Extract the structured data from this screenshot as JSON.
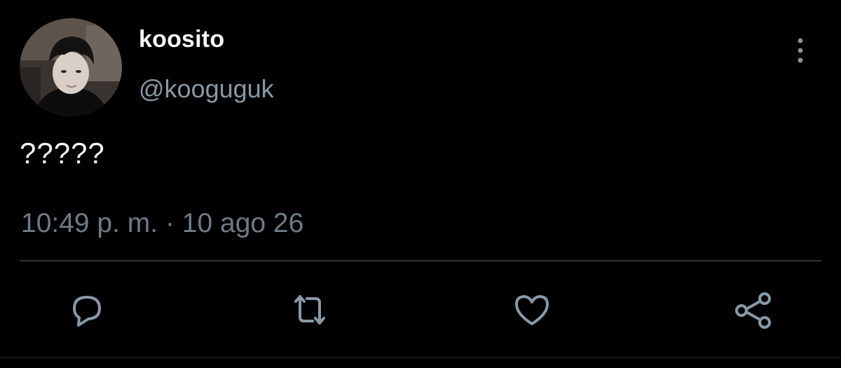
{
  "tweet": {
    "display_name": "koosito",
    "handle": "@kooguguk",
    "text": "?????",
    "time": "10:49 p. m.",
    "separator": " · ",
    "date": "10 ago 26"
  },
  "icons": {
    "more": "more-vertical-icon",
    "reply": "reply-icon",
    "retweet": "retweet-icon",
    "like": "heart-icon",
    "share": "share-icon"
  },
  "colors": {
    "background": "#000000",
    "primary_text": "#f5f8fa",
    "secondary_text": "#8899a6",
    "icon": "#8899a6",
    "divider": "#2f3336"
  }
}
